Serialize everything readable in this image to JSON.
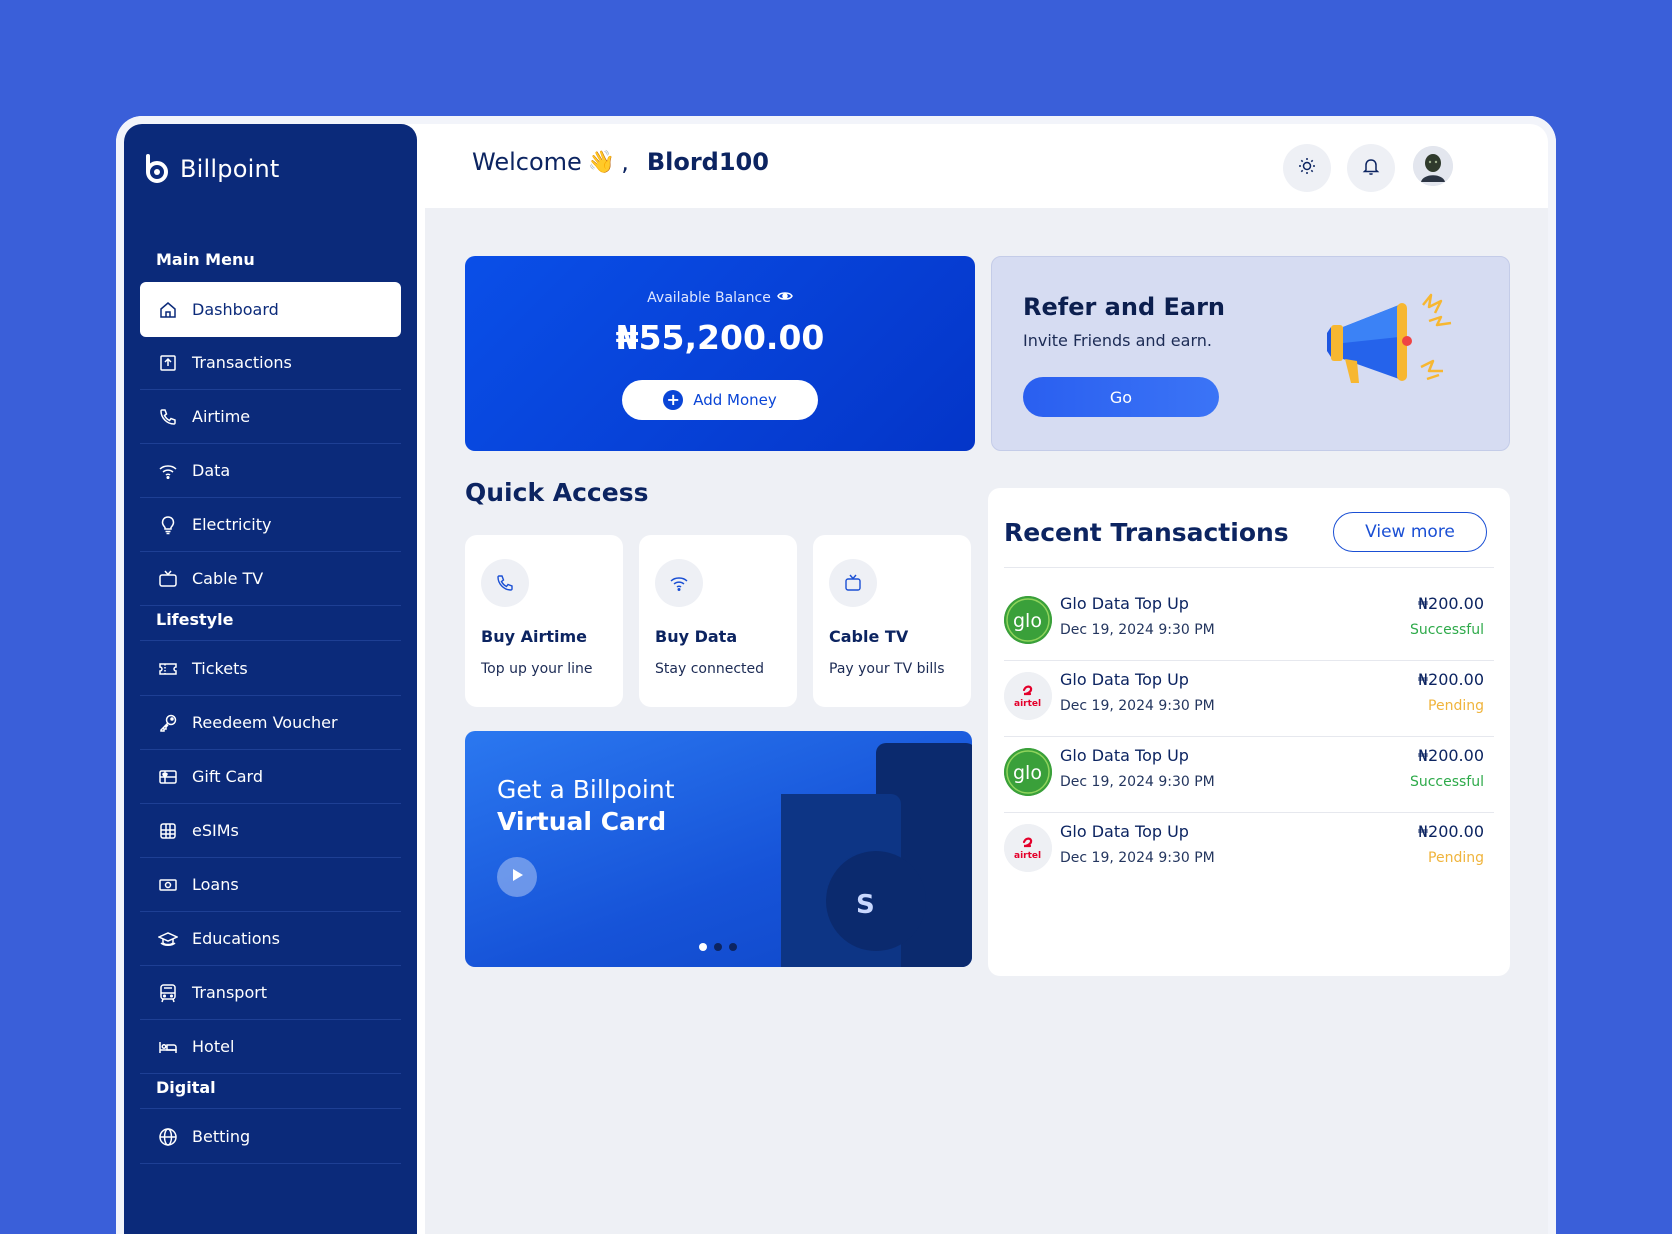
{
  "brand": {
    "name": "Billpoint"
  },
  "sidebar": {
    "sections": {
      "main": "Main Menu",
      "lifestyle": "Lifestyle",
      "digital": "Digital"
    },
    "items": [
      {
        "label": "Dashboard",
        "icon": "home-icon",
        "active": true
      },
      {
        "label": "Transactions",
        "icon": "receipt-icon"
      },
      {
        "label": "Airtime",
        "icon": "phone-icon"
      },
      {
        "label": "Data",
        "icon": "wifi-icon"
      },
      {
        "label": "Electricity",
        "icon": "bulb-icon"
      },
      {
        "label": "Cable TV",
        "icon": "tv-icon"
      },
      {
        "label": "Tickets",
        "icon": "ticket-icon"
      },
      {
        "label": "Reedeem Voucher",
        "icon": "key-icon"
      },
      {
        "label": "Gift Card",
        "icon": "gift-card-icon"
      },
      {
        "label": "eSIMs",
        "icon": "sim-icon"
      },
      {
        "label": "Loans",
        "icon": "cash-icon"
      },
      {
        "label": "Educations",
        "icon": "graduation-icon"
      },
      {
        "label": "Transport",
        "icon": "bus-icon"
      },
      {
        "label": "Hotel",
        "icon": "bed-icon"
      },
      {
        "label": "Betting",
        "icon": "globe-icon"
      }
    ]
  },
  "header": {
    "welcome": "Welcome",
    "emoji": "👋",
    "comma": ",",
    "username": "Blord100"
  },
  "balance": {
    "label": "Available Balance",
    "amount": "₦55,200.00",
    "add_money": "Add Money"
  },
  "refer": {
    "title": "Refer and Earn",
    "subtitle": "Invite Friends and earn.",
    "button": "Go"
  },
  "quick_access": {
    "title": "Quick Access",
    "cards": [
      {
        "name": "Buy Airtime",
        "desc": "Top up your line",
        "icon": "phone-icon"
      },
      {
        "name": "Buy Data",
        "desc": "Stay connected",
        "icon": "wifi-icon"
      },
      {
        "name": "Cable TV",
        "desc": "Pay your TV bills",
        "icon": "tv-icon"
      }
    ]
  },
  "promo": {
    "line1": "Get a Billpoint",
    "line2": "Virtual Card",
    "card_letter": "S"
  },
  "recent": {
    "title": "Recent Transactions",
    "view_more": "View more",
    "rows": [
      {
        "title": "Glo Data Top Up",
        "date": "Dec 19, 2024 9:30 PM",
        "amount": "₦200.00",
        "status": "Successful",
        "logo": "glo"
      },
      {
        "title": "Glo Data Top Up",
        "date": "Dec 19, 2024 9:30 PM",
        "amount": "₦200.00",
        "status": "Pending",
        "logo": "airtel"
      },
      {
        "title": "Glo Data Top Up",
        "date": "Dec 19, 2024 9:30 PM",
        "amount": "₦200.00",
        "status": "Successful",
        "logo": "glo"
      },
      {
        "title": "Glo Data Top Up",
        "date": "Dec 19, 2024 9:30 PM",
        "amount": "₦200.00",
        "status": "Pending",
        "logo": "airtel"
      }
    ]
  },
  "colors": {
    "sidebar": "#0b2a7a",
    "accent": "#0a45d6",
    "success": "#2eaa4a",
    "pending": "#f0b43c",
    "page_bg": "#3a5fd9"
  }
}
